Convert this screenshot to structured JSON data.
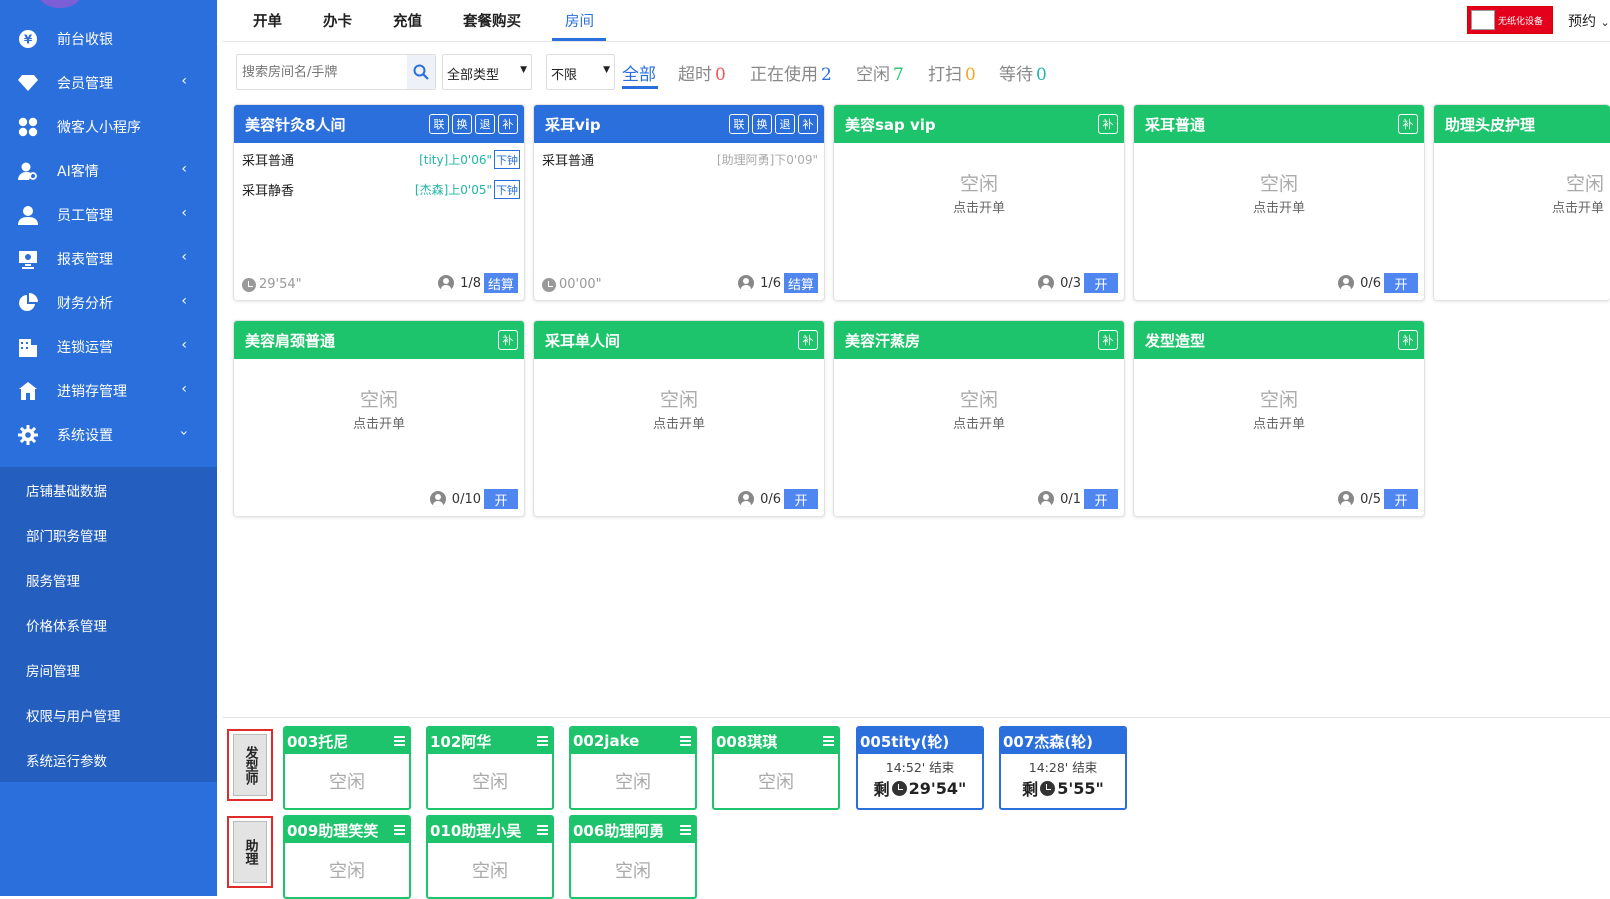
{
  "sidebar": {
    "items": [
      {
        "label": "前台收银",
        "icon": "yen-coin-icon"
      },
      {
        "label": "会员管理",
        "icon": "diamond-icon"
      },
      {
        "label": "微客人小程序",
        "icon": "grid-flower-icon"
      },
      {
        "label": "AI客情",
        "icon": "user-search-icon"
      },
      {
        "label": "员工管理",
        "icon": "user-icon"
      },
      {
        "label": "报表管理",
        "icon": "monitor-chart-icon"
      },
      {
        "label": "财务分析",
        "icon": "pie-chart-icon"
      },
      {
        "label": "连锁运营",
        "icon": "building-icon"
      },
      {
        "label": "进销存管理",
        "icon": "store-icon"
      },
      {
        "label": "系统设置",
        "icon": "gear-icon"
      }
    ],
    "sub_items": [
      {
        "label": "店铺基础数据"
      },
      {
        "label": "部门职务管理"
      },
      {
        "label": "服务管理"
      },
      {
        "label": "价格体系管理"
      },
      {
        "label": "房间管理"
      },
      {
        "label": "权限与用户管理"
      },
      {
        "label": "系统运行参数"
      }
    ]
  },
  "topbar": {
    "tabs": [
      {
        "label": "开单"
      },
      {
        "label": "办卡"
      },
      {
        "label": "充值"
      },
      {
        "label": "套餐购买"
      },
      {
        "label": "房间"
      }
    ],
    "active_tab": "房间",
    "brand_badge": "无纸化设备",
    "reserve_label": "预约"
  },
  "filters": {
    "search_placeholder": "搜索房间名/手牌",
    "type_select": "全部类型",
    "limit_select": "不限",
    "status": [
      {
        "label": "全部",
        "count": "",
        "color": "#2a6fdb"
      },
      {
        "label": "超时",
        "count": "0",
        "color": "#f05656"
      },
      {
        "label": "正在使用",
        "count": "2",
        "color": "#2a6fdb"
      },
      {
        "label": "空闲",
        "count": "7",
        "color": "#1ec46b"
      },
      {
        "label": "打扫",
        "count": "0",
        "color": "#f5a623"
      },
      {
        "label": "等待",
        "count": "0",
        "color": "#21b5a8"
      }
    ]
  },
  "rooms": [
    {
      "name": "美容针灸8人间",
      "state": "busy",
      "buttons": [
        "联",
        "换",
        "退",
        "补"
      ],
      "services": [
        {
          "name": "采耳普通",
          "meta": "[tity]上0'06\"",
          "action": "下钟"
        },
        {
          "name": "采耳静香",
          "meta": "[杰森]上0'05\"",
          "action": "下钟"
        }
      ],
      "timer": "29'54\"",
      "occupancy": "1/8",
      "action": "结算"
    },
    {
      "name": "采耳vip",
      "state": "busy",
      "buttons": [
        "联",
        "换",
        "退",
        "补"
      ],
      "services": [
        {
          "name": "采耳普通",
          "meta": "[助理阿勇]下0'09\"",
          "action": ""
        }
      ],
      "timer": "00'00\"",
      "occupancy": "1/6",
      "action": "结算"
    },
    {
      "name": "美容sap vip",
      "state": "idle",
      "buttons": [
        "补"
      ],
      "idle_text": "空闲",
      "idle_sub": "点击开单",
      "occupancy": "0/3",
      "action": "开"
    },
    {
      "name": "采耳普通",
      "state": "idle",
      "buttons": [
        "补"
      ],
      "idle_text": "空闲",
      "idle_sub": "点击开单",
      "occupancy": "0/6",
      "action": "开"
    },
    {
      "name": "助理头皮护理",
      "state": "idle",
      "buttons": [],
      "idle_text": "空闲",
      "idle_sub": "点击开单",
      "occupancy": "",
      "action": ""
    },
    {
      "name": "美容肩颈普通",
      "state": "idle",
      "buttons": [
        "补"
      ],
      "idle_text": "空闲",
      "idle_sub": "点击开单",
      "occupancy": "0/10",
      "action": "开"
    },
    {
      "name": "采耳单人间",
      "state": "idle",
      "buttons": [
        "补"
      ],
      "idle_text": "空闲",
      "idle_sub": "点击开单",
      "occupancy": "0/6",
      "action": "开"
    },
    {
      "name": "美容汗蒸房",
      "state": "idle",
      "buttons": [
        "补"
      ],
      "idle_text": "空闲",
      "idle_sub": "点击开单",
      "occupancy": "0/1",
      "action": "开"
    },
    {
      "name": "发型造型",
      "state": "idle",
      "buttons": [
        "补"
      ],
      "idle_text": "空闲",
      "idle_sub": "点击开单",
      "occupancy": "0/5",
      "action": "开"
    }
  ],
  "staff_groups": [
    {
      "label": "发型师",
      "staff": [
        {
          "name": "003托尼",
          "state": "idle",
          "text": "空闲"
        },
        {
          "name": "102阿华",
          "state": "idle",
          "text": "空闲"
        },
        {
          "name": "002jake",
          "state": "idle",
          "text": "空闲"
        },
        {
          "name": "008琪琪",
          "state": "idle",
          "text": "空闲"
        },
        {
          "name": "005tity(轮)",
          "state": "busy",
          "end": "14:52' 结束",
          "remain_prefix": "剩",
          "remain": "29'54\""
        },
        {
          "name": "007杰森(轮)",
          "state": "busy",
          "end": "14:28' 结束",
          "remain_prefix": "剩",
          "remain": "5'55\""
        }
      ]
    },
    {
      "label": "助理",
      "staff": [
        {
          "name": "009助理笑笑",
          "state": "idle",
          "text": "空闲"
        },
        {
          "name": "010助理小吴",
          "state": "idle",
          "text": "空闲"
        },
        {
          "name": "006助理阿勇",
          "state": "idle",
          "text": "空闲"
        }
      ]
    }
  ]
}
